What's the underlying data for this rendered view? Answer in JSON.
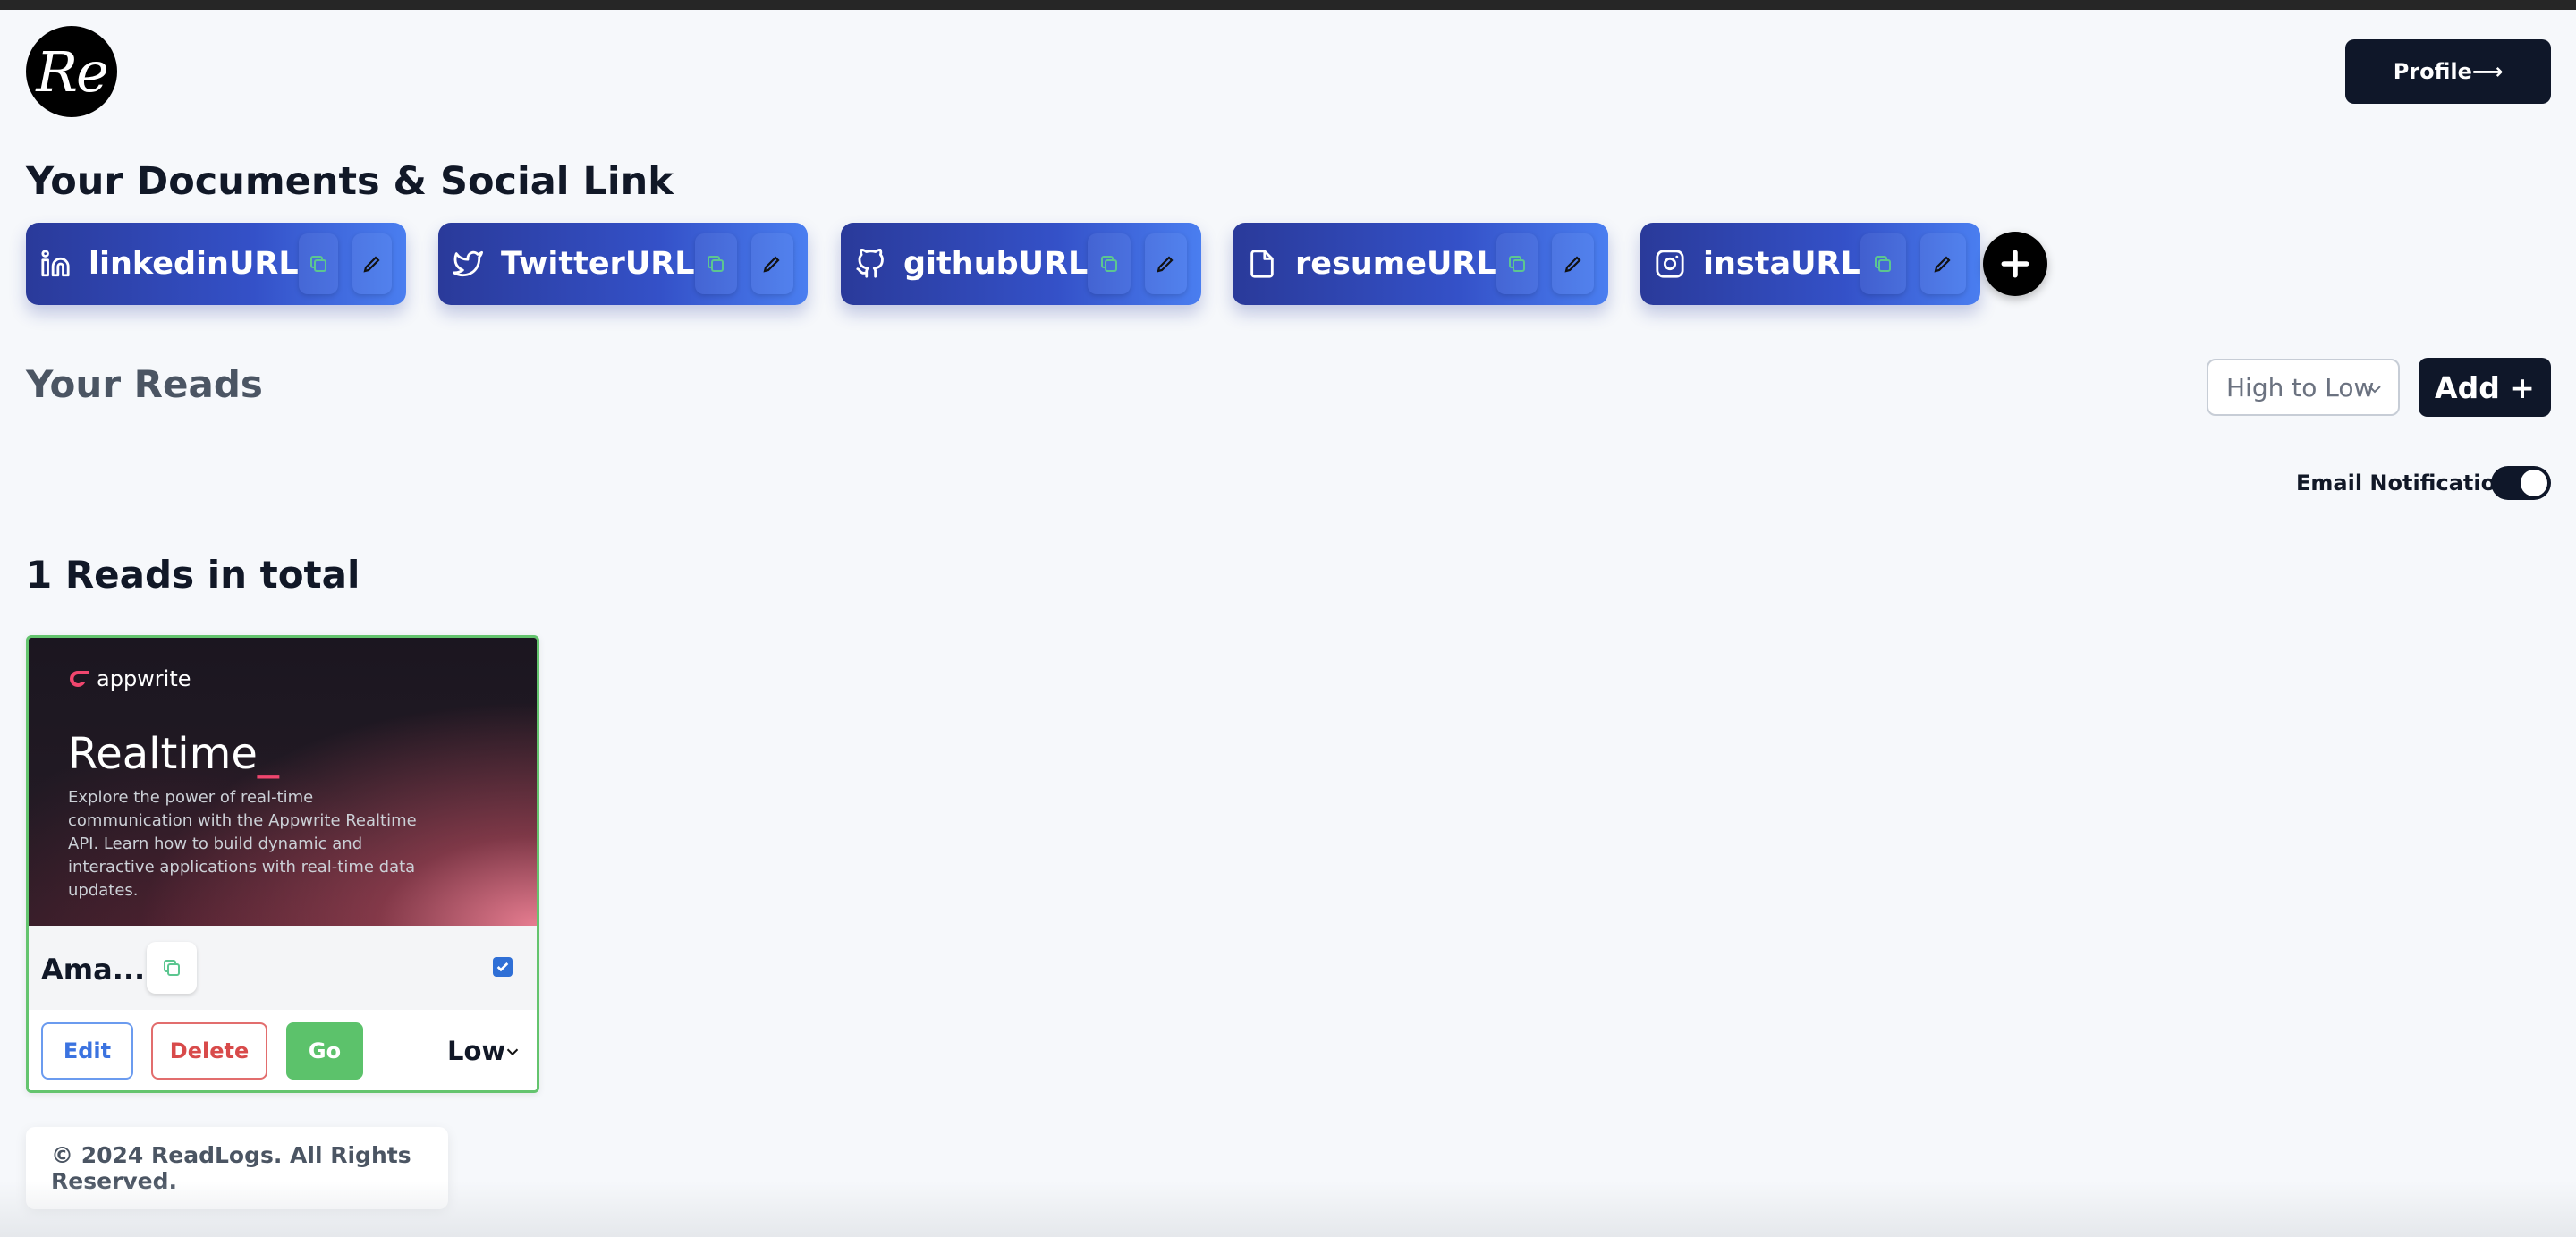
{
  "app": {
    "logo_text": "Re",
    "profile_label": "Profile⟶"
  },
  "links_section": {
    "title": "Your Documents & Social Link",
    "items": [
      {
        "label": "linkedinURL",
        "icon": "linkedin-icon"
      },
      {
        "label": "TwitterURL",
        "icon": "twitter-icon"
      },
      {
        "label": "githubURL",
        "icon": "github-icon"
      },
      {
        "label": "resumeURL",
        "icon": "document-icon"
      },
      {
        "label": "instaURL",
        "icon": "instagram-icon"
      }
    ],
    "add_icon": "plus-icon"
  },
  "reads_section": {
    "title": "Your Reads",
    "sort_selected": "High to Low",
    "add_label": "Add +",
    "email_notifications_label": "Email Notifications",
    "email_notifications_on": true,
    "count_text": "1 Reads in total"
  },
  "reads": [
    {
      "thumbnail": {
        "brand": "appwrite",
        "title": "Realtime",
        "cursor": "_",
        "description": "Explore the power of real-time communication with the Appwrite Realtime API. Learn how to build dynamic and interactive applications with real-time data updates."
      },
      "title": "Ama...",
      "checked": true,
      "edit_label": "Edit",
      "delete_label": "Delete",
      "go_label": "Go",
      "priority": "Low"
    }
  ],
  "footer": {
    "text": "© 2024 ReadLogs. All Rights Reserved."
  },
  "colors": {
    "primary_dark": "#0f1729",
    "chip_gradient_start": "#2a3a9a",
    "chip_gradient_end": "#4a7ef0",
    "go_green": "#5cc26b",
    "delete_red": "#d84a4a",
    "edit_blue": "#3b73e0",
    "card_border": "#64c46e",
    "copy_icon_green": "#5cc690"
  }
}
